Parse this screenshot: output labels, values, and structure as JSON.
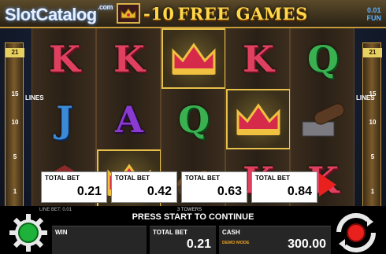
{
  "header": {
    "logo": "SlotCatalog",
    "logo_suffix": ".com",
    "promo_prefix": "-10",
    "promo_text": "FREE GAMES",
    "fun_value": "0.01",
    "fun_label": "FUN"
  },
  "lines": {
    "left_numbers": [
      "21",
      "15",
      "10",
      "5",
      "1"
    ],
    "right_numbers": [
      "21",
      "15",
      "10",
      "5",
      "1"
    ],
    "label": "LINES"
  },
  "reels": [
    [
      "K",
      "J",
      "scatter"
    ],
    [
      "K",
      "A",
      "crown"
    ],
    [
      "crown",
      "Q",
      "cannon"
    ],
    [
      "K",
      "crown",
      "K"
    ],
    [
      "Q",
      "cannon",
      "K"
    ]
  ],
  "bet_options": [
    {
      "label": "TOTAL BET",
      "value": "0.21"
    },
    {
      "label": "TOTAL BET",
      "value": "0.42"
    },
    {
      "label": "TOTAL BET",
      "value": "0.63"
    },
    {
      "label": "TOTAL BET",
      "value": "0.84"
    }
  ],
  "footer": {
    "line_bet": "LINE BET: 0.01",
    "towers": "3 TOWERS",
    "press_start": "PRESS START TO CONTINUE",
    "win_label": "WIN",
    "win_value": "",
    "total_bet_label": "TOTAL BET",
    "total_bet_value": "0.21",
    "cash_label": "CASH",
    "cash_value": "300.00",
    "demo_mode": "DEMO MODE"
  },
  "colors": {
    "accent": "#ffd84a",
    "play": "#e8201e",
    "gear": "#1fb23a"
  }
}
